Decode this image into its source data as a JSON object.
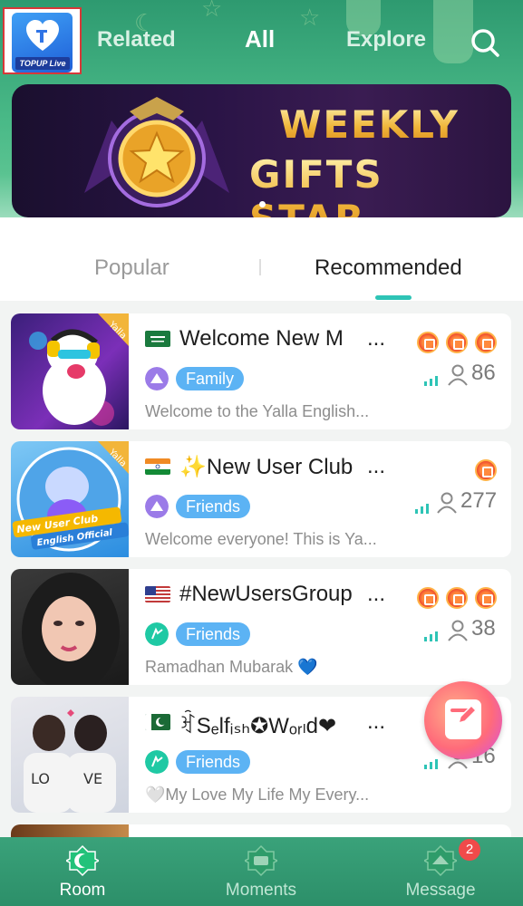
{
  "header": {
    "app_logo_text": "TOPUP Live",
    "tabs": [
      {
        "label": "Related"
      },
      {
        "label": "All"
      },
      {
        "label": "Explore"
      }
    ],
    "search_icon": "search-icon"
  },
  "banner": {
    "line1": "WEEKLY",
    "line2": "GIFTS STAR"
  },
  "sub_tabs": {
    "popular": "Popular",
    "recommended": "Recommended"
  },
  "rooms": [
    {
      "flag": "sa",
      "title": "Welcome New M",
      "type": "Family",
      "type_icon": "family-icon",
      "desc": "Welcome to the Yalla English...",
      "medals": 3,
      "count": "86",
      "tag": "Yalla"
    },
    {
      "flag": "in",
      "title": "✨New User Club",
      "type": "Friends",
      "type_icon": "friends-icon",
      "desc": "Welcome everyone! This is Ya...",
      "medals": 1,
      "count": "277",
      "tag": "Yalla",
      "thumb_text1": "New User Club",
      "thumb_text2": "English Official"
    },
    {
      "flag": "us",
      "title": "#NewUsersGroup",
      "type": "Friends",
      "type_icon": "friends-icon",
      "desc": "Ramadhan Mubarak 💙",
      "medals": 3,
      "count": "38"
    },
    {
      "flag": "pk",
      "title": "ꀓSₑlfᵢₛₕ✪Wₒᵣₗd❤",
      "type": "Friends",
      "type_icon": "friends-icon",
      "desc": "🤍My Love My Life My Every...",
      "medals": 1,
      "count": "16"
    }
  ],
  "ellipsis": "...",
  "bottom_nav": [
    {
      "label": "Room",
      "icon": "room-icon",
      "active": true
    },
    {
      "label": "Moments",
      "icon": "moments-icon"
    },
    {
      "label": "Message",
      "icon": "message-icon",
      "badge": "2"
    }
  ],
  "colors": {
    "header_green": "#2e9a70",
    "tab_underline": "#2ec4b6",
    "type_badge": "#5cb3f4",
    "nav_bg": "#3aa27a"
  }
}
